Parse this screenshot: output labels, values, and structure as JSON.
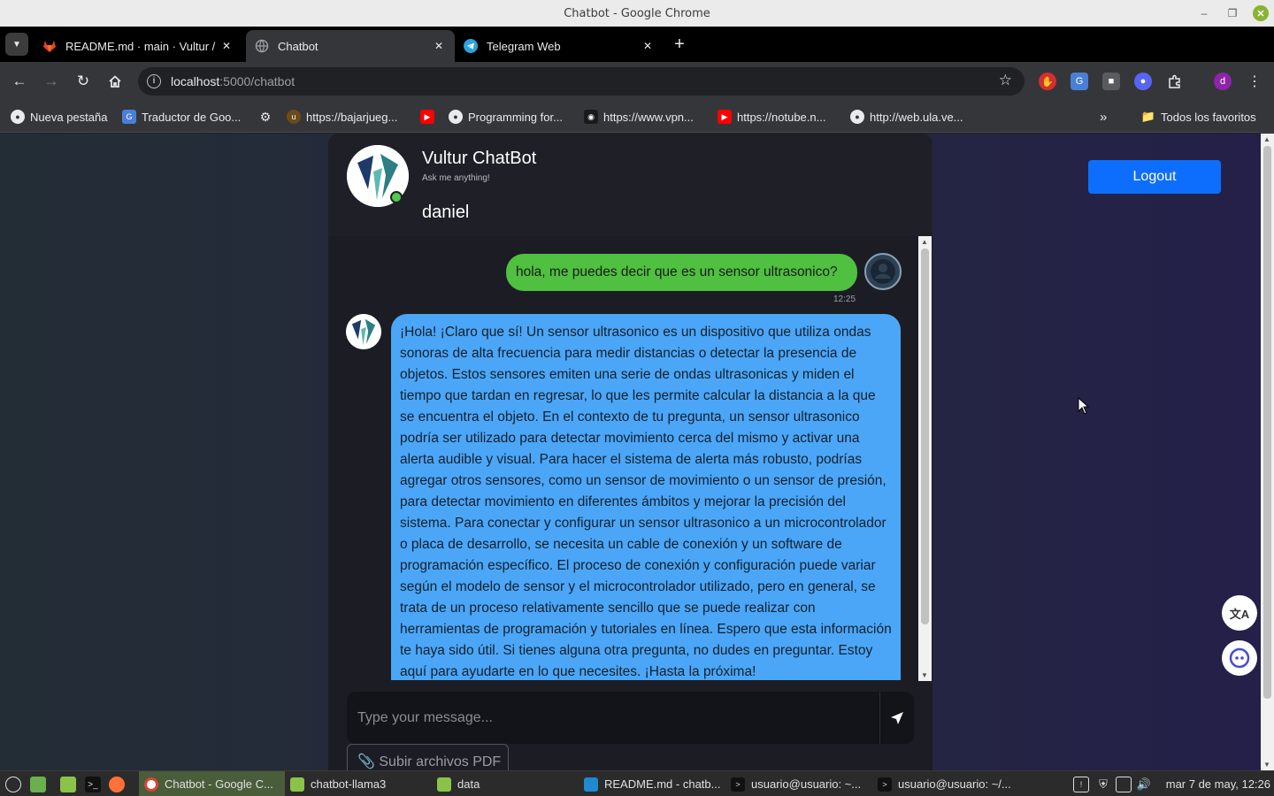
{
  "window": {
    "title": "Chatbot - Google Chrome"
  },
  "tabs": [
    {
      "label": "README.md · main · Vultur /",
      "icon": "gitlab-icon",
      "active": false
    },
    {
      "label": "Chatbot",
      "icon": "globe-icon",
      "active": true
    },
    {
      "label": "Telegram Web",
      "icon": "telegram-icon",
      "active": false
    }
  ],
  "address_bar": {
    "host": "localhost",
    "path": ":5000/chatbot"
  },
  "bookmarks": [
    {
      "label": "Nueva pestaña",
      "icon": "chrome-icon"
    },
    {
      "label": "Traductor de Goo...",
      "icon": "translate-icon"
    },
    {
      "label": "",
      "icon": "gear-icon"
    },
    {
      "label": "https://bajarjueg...",
      "icon": "site-icon"
    },
    {
      "label": "",
      "icon": "youtube-icon"
    },
    {
      "label": "Programming for...",
      "icon": "chrome-icon"
    },
    {
      "label": "https://www.vpn...",
      "icon": "hacker-icon"
    },
    {
      "label": "https://notube.n...",
      "icon": "youtube-icon"
    },
    {
      "label": "http://web.ula.ve...",
      "icon": "chrome-icon"
    }
  ],
  "bookmarks_all": "Todos los favoritos",
  "chat": {
    "bot_name": "Vultur ChatBot",
    "bot_subtitle": "Ask me anything!",
    "user_name": "daniel",
    "messages": [
      {
        "from": "user",
        "text": "hola, me puedes decir que es un sensor ultrasonico?",
        "time": "12:25"
      },
      {
        "from": "bot",
        "text": "¡Hola! ¡Claro que sí! Un sensor ultrasonico es un dispositivo que utiliza ondas sonoras de alta frecuencia para medir distancias o detectar la presencia de objetos. Estos sensores emiten una serie de ondas ultrasonicas y miden el tiempo que tardan en regresar, lo que les permite calcular la distancia a la que se encuentra el objeto. En el contexto de tu pregunta, un sensor ultrasonico podría ser utilizado para detectar movimiento cerca del mismo y activar una alerta audible y visual. Para hacer el sistema de alerta más robusto, podrías agregar otros sensores, como un sensor de movimiento o un sensor de presión, para detectar movimiento en diferentes ámbitos y mejorar la precisión del sistema. Para conectar y configurar un sensor ultrasonico a un microcontrolador o placa de desarrollo, se necesita un cable de conexión y un software de programación específico. El proceso de conexión y configuración puede variar según el modelo de sensor y el microcontrolador utilizado, pero en general, se trata de un proceso relativamente sencillo que se puede realizar con herramientas de programación y tutoriales en línea. Espero que esta información te haya sido útil. Si tienes alguna otra pregunta, no dudes en preguntar. Estoy aquí para ayudarte en lo que necesites. ¡Hasta la próxima!"
      }
    ],
    "input_placeholder": "Type your message...",
    "upload_label": "Subir archivos PDF"
  },
  "logout_label": "Logout",
  "taskbar": {
    "items": [
      {
        "label": "Chatbot - Google C...",
        "icon": "chrome-icon",
        "active": true
      },
      {
        "label": "chatbot-llama3",
        "icon": "folder-icon",
        "active": false
      },
      {
        "label": "data",
        "icon": "folder-icon",
        "active": false
      },
      {
        "label": "README.md - chatb...",
        "icon": "vscode-icon",
        "active": false
      },
      {
        "label": "usuario@usuario: ~...",
        "icon": "terminal-icon",
        "active": false
      },
      {
        "label": "usuario@usuario: ~/...",
        "icon": "terminal-icon",
        "active": false
      }
    ],
    "clock": "mar 7 de may, 12:26"
  },
  "colors": {
    "user_bubble": "#4fc03f",
    "bot_bubble": "#4ba6f7",
    "logout": "#0d6efd",
    "online": "#4ccd4c"
  }
}
